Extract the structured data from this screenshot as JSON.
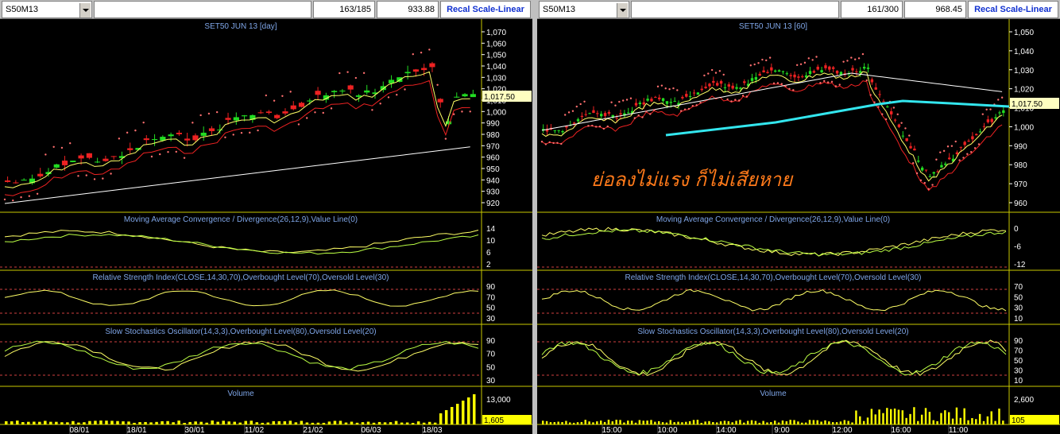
{
  "left": {
    "symbol": "S50M13",
    "counter": "163/185",
    "value": "933.88",
    "recal_label": "Recal Scale-Linear",
    "main_title": "SET50 JUN 13   [day]",
    "price_ticks": [
      "1,070",
      "1,060",
      "1,050",
      "1,040",
      "1,030",
      "1,020",
      "1,010",
      "1,000",
      "990",
      "980",
      "970",
      "960",
      "950",
      "940",
      "930",
      "920"
    ],
    "last_price": "1,017.50",
    "macd_title": "Moving Average Convergence / Divergence(26,12,9),Value Line(0)",
    "macd_ticks": [
      "14",
      "10",
      "6",
      "2"
    ],
    "rsi_title": "Relative Strength Index(CLOSE,14,30,70),Overbought Level(70),Oversold Level(30)",
    "rsi_ticks": [
      "90",
      "70",
      "50",
      "30"
    ],
    "stoch_title": "Slow Stochastics Oscillator(14,3,3),Overbought Level(80),Oversold Level(20)",
    "stoch_ticks": [
      "90",
      "70",
      "50",
      "30"
    ],
    "volume_title": "Volume",
    "volume_tick": "13,000",
    "last_volume": "1,605",
    "dates": [
      "08/01",
      "18/01",
      "30/01",
      "11/02",
      "21/02",
      "06/03",
      "18/03"
    ]
  },
  "right": {
    "symbol": "S50M13",
    "counter": "161/300",
    "value": "968.45",
    "recal_label": "Recal Scale-Linear",
    "main_title": "SET50 JUN 13   [60]",
    "annotation": "ย่อลงไม่แรง ก็ไม่เสียหาย",
    "price_ticks": [
      "1,050",
      "1,040",
      "1,030",
      "1,020",
      "1,010",
      "1,000",
      "990",
      "980",
      "970",
      "960"
    ],
    "last_price": "1,017.50",
    "macd_title": "Moving Average Convergence / Divergence(26,12,9),Value Line(0)",
    "macd_ticks": [
      "0",
      "-6",
      "-12"
    ],
    "rsi_title": "Relative Strength Index(CLOSE,14,30,70),Overbought Level(70),Oversold Level(30)",
    "rsi_ticks": [
      "70",
      "50",
      "30",
      "10"
    ],
    "stoch_title": "Slow Stochastics Oscillator(14,3,3),Overbought Level(80),Oversold Level(20)",
    "stoch_ticks": [
      "90",
      "70",
      "50",
      "30",
      "10"
    ],
    "volume_title": "Volume",
    "volume_tick": "2,600",
    "last_volume": "105",
    "times": [
      "15:00",
      "10:00",
      "14:00",
      "9:00",
      "12:00",
      "16:00",
      "11:00"
    ]
  },
  "colors": {
    "up": "#22dd22",
    "down": "#ee2222",
    "ma_fast": "#ffff66",
    "ma_mid": "#ee2222",
    "ma_slow": "#ffffff",
    "ma_long": "#33e6ee",
    "sar": "#ff6f6f",
    "grid_line": "#c8c800",
    "level": "#d04040"
  }
}
